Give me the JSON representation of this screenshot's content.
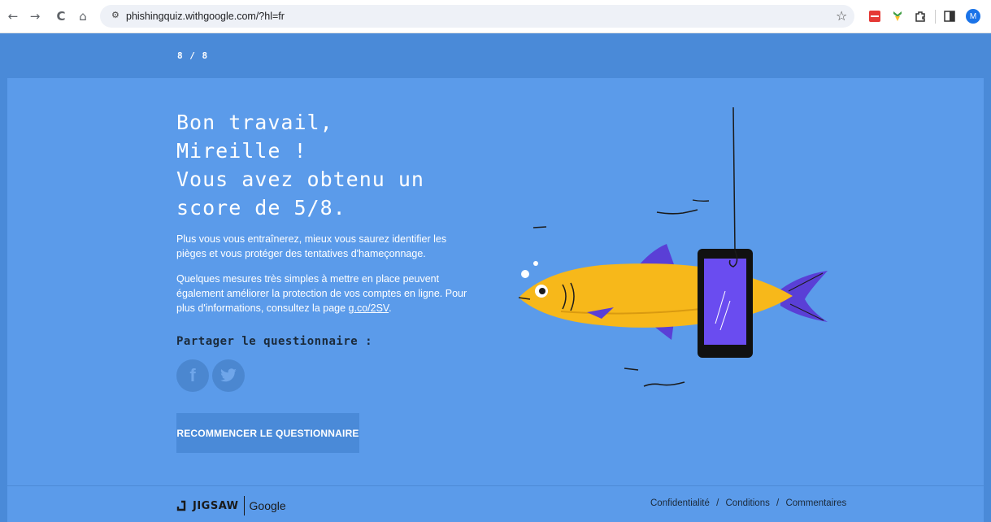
{
  "browser": {
    "url": "phishingquiz.withgoogle.com/?hl=fr",
    "profile_initial": "M",
    "nav": {
      "back": "←",
      "forward": "→",
      "reload": "C",
      "home": "⌂"
    },
    "site_info_icon": "⚙",
    "bookmark_icon": "☆"
  },
  "quiz": {
    "progress": "8 / 8"
  },
  "result": {
    "headline_lines": [
      "Bon travail,",
      "Mireille !",
      "Vous avez obtenu un",
      "score de 5/8."
    ],
    "paragraph1": "Plus vous vous entraînerez, mieux vous saurez identifier les pièges et vous protéger des tentatives d'hameçonnage.",
    "paragraph2_prefix": "Quelques mesures très simples à mettre en place peuvent également améliorer la protection de vos comptes en ligne. Pour plus d'informations, consultez la page ",
    "paragraph2_link": "g.co/2SV",
    "paragraph2_suffix": "."
  },
  "share": {
    "title": "Partager le questionnaire :",
    "facebook_glyph": "f",
    "twitter_glyph": "t"
  },
  "actions": {
    "restart_label": "RECOMMENCER LE QUESTIONNAIRE"
  },
  "footer": {
    "brand_jigsaw": "JIGSAW",
    "brand_google": "Google",
    "links": [
      "Confidentialité",
      "Conditions",
      "Commentaires"
    ],
    "separator": "/"
  },
  "colors": {
    "background": "#5b9bea",
    "header": "#4a8ad8",
    "fish": "#f7b81a",
    "fins": "#5a3fd6",
    "phone_screen": "#6a4cf0"
  }
}
